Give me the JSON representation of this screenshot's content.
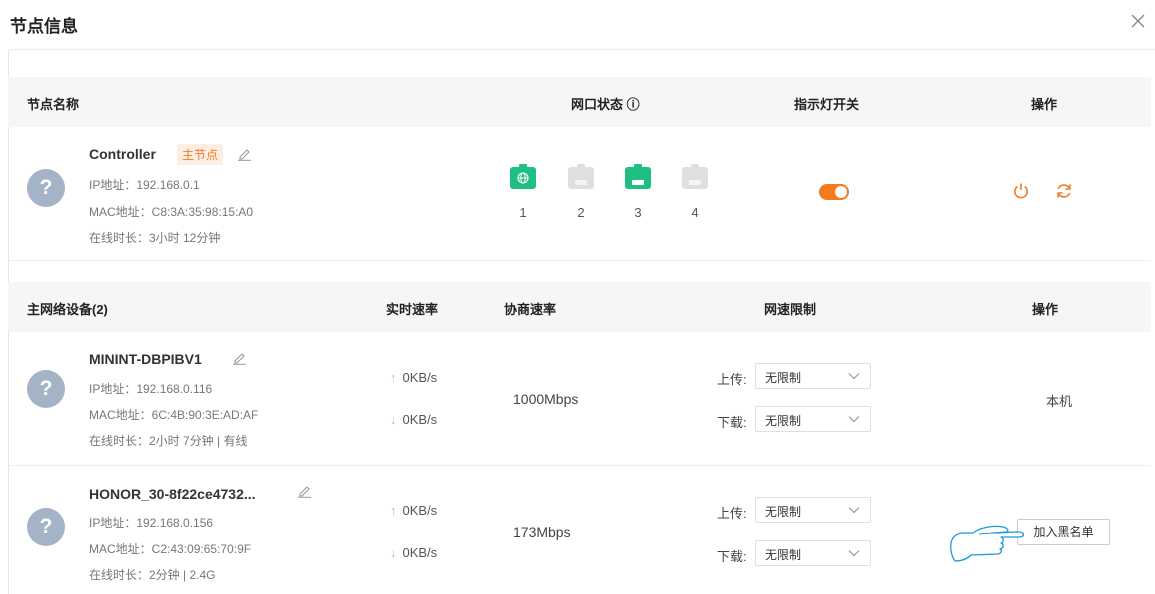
{
  "dialog": {
    "title": "节点信息"
  },
  "node_table": {
    "headers": {
      "name": "节点名称",
      "port_status": "网口状态 ⓘ",
      "led": "指示灯开关",
      "action": "操作"
    },
    "node": {
      "name": "Controller",
      "tag": "主节点",
      "ip": "IP地址：192.168.0.1",
      "mac": "MAC地址：C8:3A:35:98:15:A0",
      "online": "在线时长：3小时 12分钟",
      "ports": [
        {
          "num": "1",
          "state": "on"
        },
        {
          "num": "2",
          "state": "off"
        },
        {
          "num": "3",
          "state": "on"
        },
        {
          "num": "4",
          "state": "off"
        }
      ],
      "led_on": true
    }
  },
  "device_table": {
    "headers": {
      "device": "主网络设备(2)",
      "realtime": "实时速率",
      "negotiated": "协商速率",
      "limit": "网速限制",
      "action": "操作"
    },
    "rows": [
      {
        "name": "MININT-DBPIBV1",
        "ip": "IP地址：192.168.0.116",
        "mac": "MAC地址：6C:4B:90:3E:AD:AF",
        "online": "在线时长：2小时 7分钟 | 有线",
        "up": "0KB/s",
        "down": "0KB/s",
        "negotiated": "1000Mbps",
        "upload_label": "上传:",
        "upload_value": "无限制",
        "download_label": "下载:",
        "download_value": "无限制",
        "action": "本机"
      },
      {
        "name": "HONOR_30-8f22ce4732...",
        "ip": "IP地址：192.168.0.156",
        "mac": "MAC地址：C2:43:09:65:70:9F",
        "online": "在线时长：2分钟 | 2.4G",
        "up": "0KB/s",
        "down": "0KB/s",
        "negotiated": "173Mbps",
        "upload_label": "上传:",
        "upload_value": "无限制",
        "download_label": "下载:",
        "download_value": "无限制",
        "action": "加入黑名单"
      }
    ]
  },
  "colors": {
    "accent": "#f57a1c",
    "port_on": "#1fbe83",
    "port_off": "#dedfe1",
    "avatar": "#a4b4c6",
    "header_bg": "#f5f6f8"
  },
  "icons": [
    "close-icon",
    "edit-icon",
    "globe-icon",
    "power-icon",
    "refresh-icon",
    "chevron-down-icon",
    "pointer-hand-icon",
    "info-icon",
    "avatar-unknown-icon"
  ]
}
